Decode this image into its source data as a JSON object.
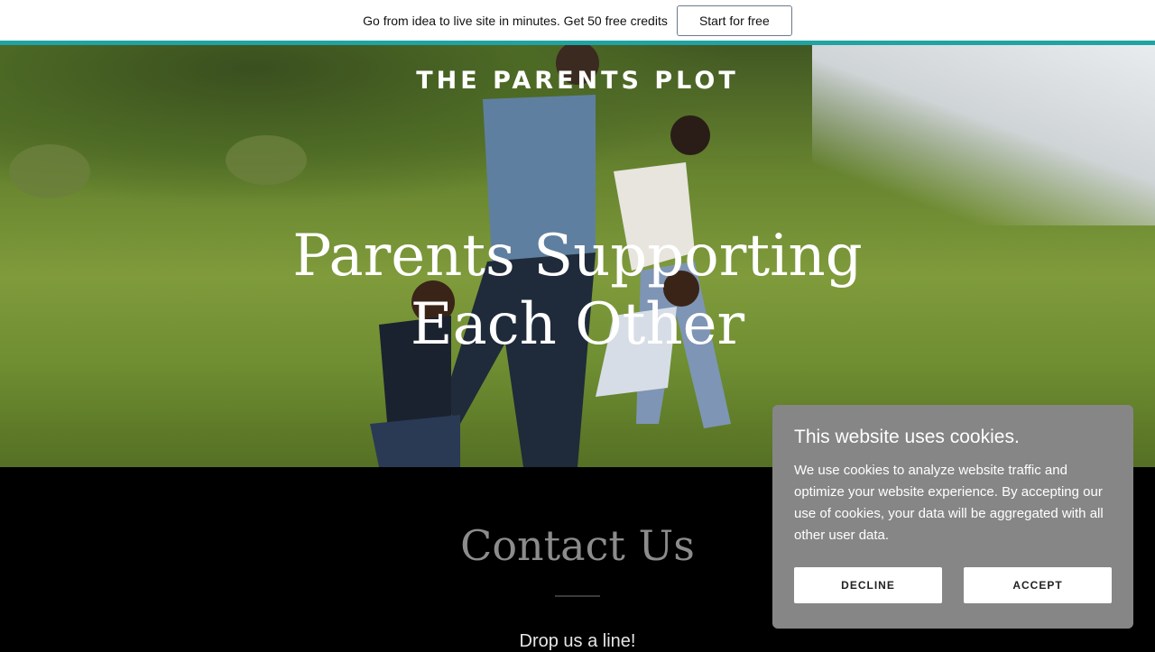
{
  "promo": {
    "text": "Go from idea to live site in minutes. Get 50 free credits",
    "button_label": "Start for free"
  },
  "hero": {
    "site_title": "THE PARENTS PLOT",
    "tagline": "Parents Supporting Each Other"
  },
  "contact": {
    "title": "Contact Us",
    "subtitle": "Drop us a line!"
  },
  "cookie_banner": {
    "title": "This website uses cookies.",
    "body": "We use cookies to analyze website traffic and optimize your website experience. By accepting our use of cookies, your data will be aggregated with all other user data.",
    "decline_label": "DECLINE",
    "accept_label": "ACCEPT"
  },
  "colors": {
    "accent_bar": "#1fa3a3",
    "cookie_bg": "#868686"
  }
}
